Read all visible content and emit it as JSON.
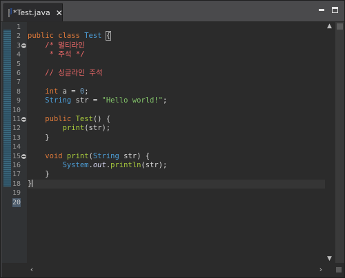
{
  "tab": {
    "title": "*Test.java",
    "close_label": "✕",
    "icon": "java-file-icon"
  },
  "window_controls": {
    "minimize_icon": "minimize-icon",
    "maximize_icon": "maximize-icon"
  },
  "line_numbers": [
    "1",
    "2",
    "3",
    "4",
    "5",
    "6",
    "7",
    "8",
    "9",
    "10",
    "11",
    "12",
    "13",
    "14",
    "15",
    "16",
    "17",
    "18",
    "19",
    "20"
  ],
  "code": {
    "l2": {
      "kw1": "public",
      "kw2": "class",
      "cls": "Test",
      "brace": "{"
    },
    "l3": {
      "comment": "/* 멀티라인"
    },
    "l4": {
      "comment": " * 주석 */"
    },
    "l6": {
      "comment": "// 싱글라인 주석"
    },
    "l8": {
      "kw": "int",
      "rest": " a = ",
      "num": "0",
      "end": ";"
    },
    "l9": {
      "cls": "String",
      "rest": " str = ",
      "str": "\"Hello world!\"",
      "end": ";"
    },
    "l11": {
      "kw": "public",
      "fn": "Test",
      "rest": "() {"
    },
    "l12": {
      "fn": "print",
      "rest": "(str);"
    },
    "l13": {
      "brace": "}"
    },
    "l15": {
      "kw": "void",
      "fn": "print",
      "p1": "(",
      "cls": "String",
      "p2": " str) {"
    },
    "l16": {
      "cls": "System",
      "dot1": ".",
      "out": "out",
      "dot2": ".",
      "fn": "println",
      "rest": "(str);"
    },
    "l17": {
      "brace": "}"
    },
    "l18": {
      "brace": "}"
    }
  },
  "scroll": {
    "up": "▲",
    "down": "▼",
    "left": "‹",
    "right": "›"
  },
  "colors": {
    "keyword": "#e07a3a",
    "class": "#4c9dd6",
    "comment": "#f06a6a",
    "string": "#83c46a",
    "number": "#6c99bb",
    "method": "#a6c83c",
    "background": "#2b2b2b"
  }
}
